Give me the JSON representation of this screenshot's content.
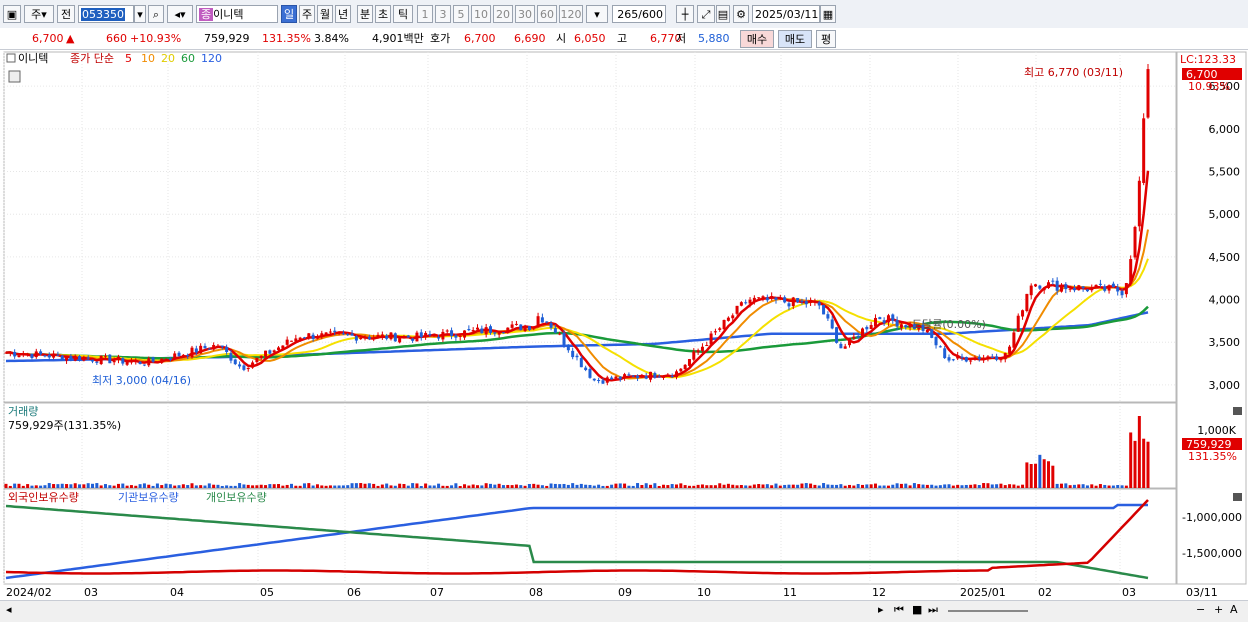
{
  "toolbar": {
    "market": "주",
    "prev": "전",
    "code": "053350",
    "name_badge": "종",
    "name": "이니텍",
    "periods": [
      "일",
      "주",
      "월",
      "년",
      "분",
      "초",
      "틱"
    ],
    "active_period": "일",
    "intervals": [
      "1",
      "3",
      "5",
      "10",
      "20",
      "30",
      "60",
      "120"
    ],
    "count": "265",
    "count_total": "/600",
    "date": "2025/03/11"
  },
  "info": {
    "price": "6,700",
    "arrow": "▲",
    "change": "660",
    "change_pct": "+10.93%",
    "volume": "759,929",
    "volume_ratio": "131.35%",
    "turnover": "3.84%",
    "amount": "4,901백만",
    "hoga_label": "호가",
    "ask": "6,700",
    "bid": "6,690",
    "open_label": "시",
    "open": "6,050",
    "high_label": "고",
    "high": "6,770",
    "low_label": "저",
    "low": "5,880",
    "buy_label": "매수",
    "sell_label": "매도",
    "eval_label": "평"
  },
  "legend": {
    "stock": "이니텍",
    "ma_label": "종가 단순",
    "ma_periods": [
      "5",
      "10",
      "20",
      "60",
      "120"
    ],
    "volume_title": "거래량",
    "volume_value": "759,929주(131.35%)",
    "holdings": [
      "외국인보유수량",
      "기관보유수량",
      "개인보유수량"
    ]
  },
  "annotations": {
    "lc": "LC:123.33",
    "high_note": "최고 6,770 (03/11)",
    "low_note": "최저 3,000 (04/16)",
    "last_price": "6,700",
    "last_pct": "10.93%",
    "vol_last": "759,929",
    "vol_pct": "131.35%",
    "mid_label": "도달률(0.00%)"
  },
  "colors": {
    "up": "#e00000",
    "down": "#1f5fd6",
    "ma5": "#e00000",
    "ma10": "#f08c00",
    "ma20": "#f5e000",
    "ma60": "#1a9a3a",
    "ma120": "#2a5fe0",
    "foreign": "#d40000",
    "inst": "#2a5fe0",
    "indiv": "#2a8a4a"
  },
  "chart_data": [
    {
      "type": "candlestick",
      "title": "이니텍",
      "x_labels": [
        "2024/02",
        "03",
        "04",
        "05",
        "06",
        "07",
        "08",
        "09",
        "10",
        "11",
        "12",
        "2025/01",
        "02",
        "03",
        "03/11"
      ],
      "price_axis": [
        "3,000",
        "3,500",
        "4,000",
        "4,500",
        "5,000",
        "5,500",
        "6,000",
        "6,500"
      ],
      "ylim": [
        2800,
        6900
      ],
      "series_keypoints": {
        "ma5": [
          [
            0,
            3380
          ],
          [
            0.12,
            3260
          ],
          [
            0.18,
            3470
          ],
          [
            0.2,
            3200
          ],
          [
            0.25,
            3580
          ],
          [
            0.35,
            3560
          ],
          [
            0.45,
            3700
          ],
          [
            0.45,
            3820
          ],
          [
            0.46,
            3750
          ],
          [
            0.5,
            3050
          ],
          [
            0.57,
            3150
          ],
          [
            0.63,
            4000
          ],
          [
            0.69,
            3950
          ],
          [
            0.71,
            3420
          ],
          [
            0.74,
            3800
          ],
          [
            0.78,
            3650
          ],
          [
            0.8,
            3300
          ],
          [
            0.85,
            3350
          ],
          [
            0.87,
            4200
          ],
          [
            0.9,
            4150
          ],
          [
            0.95,
            4100
          ],
          [
            0.96,
            4900
          ],
          [
            0.97,
            6700
          ]
        ],
        "ma120": [
          [
            0,
            3280
          ],
          [
            0.2,
            3330
          ],
          [
            0.45,
            3450
          ],
          [
            0.55,
            3480
          ],
          [
            0.65,
            3600
          ],
          [
            0.8,
            3600
          ],
          [
            0.92,
            3700
          ],
          [
            0.97,
            3850
          ]
        ]
      },
      "last_close": 6700,
      "high": 6770,
      "low": 3000
    },
    {
      "type": "bar",
      "title": "거래량",
      "yaxis": [
        "1,000K"
      ],
      "last_value": 759929
    },
    {
      "type": "line",
      "series": [
        {
          "name": "외국인보유수량"
        },
        {
          "name": "기관보유수량"
        },
        {
          "name": "개인보유수량"
        }
      ],
      "yaxis": [
        "-1,000,000",
        "-1,500,000"
      ]
    }
  ]
}
